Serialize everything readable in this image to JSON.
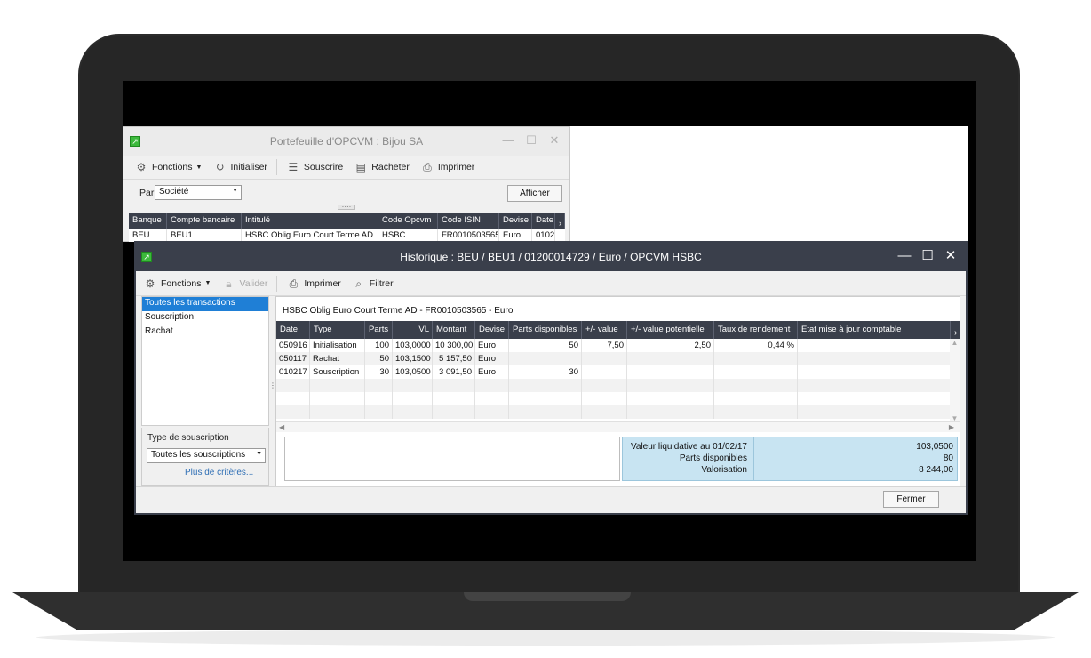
{
  "back_window": {
    "title": "Portefeuille d'OPCVM  : Bijou SA",
    "toolbar": {
      "fonctions": "Fonctions",
      "initialiser": "Initialiser",
      "souscrire": "Souscrire",
      "racheter": "Racheter",
      "imprimer": "Imprimer"
    },
    "par_label": "Par",
    "par_value": "Société",
    "afficher": "Afficher",
    "columns": [
      "Banque",
      "Compte bancaire",
      "Intitulé",
      "Code Opcvm",
      "Code ISIN",
      "Devise",
      "Date"
    ],
    "rows": [
      [
        "BEU",
        "BEU1",
        "HSBC Oblig Euro Court Terme AD",
        "HSBC",
        "FR0010503565",
        "Euro",
        "0102"
      ]
    ]
  },
  "front_window": {
    "title": "Historique : BEU / BEU1 / 01200014729 / Euro / OPCVM HSBC",
    "toolbar": {
      "fonctions": "Fonctions",
      "valider": "Valider",
      "imprimer": "Imprimer",
      "filtrer": "Filtrer"
    },
    "transaction_types": [
      "Toutes les transactions",
      "Souscription",
      "Rachat"
    ],
    "filter": {
      "label": "Type de souscription",
      "value": "Toutes les souscriptions",
      "more_link": "Plus de critères..."
    },
    "group_title": "HSBC Oblig Euro Court Terme AD - FR0010503565 - Euro",
    "columns": [
      "Date",
      "Type",
      "Parts",
      "VL",
      "Montant",
      "Devise",
      "Parts disponibles",
      "+/- value",
      "+/- value potentielle",
      "Taux de rendement",
      "Etat mise à jour comptable"
    ],
    "rows": [
      [
        "050916",
        "Initialisation",
        "100",
        "103,0000",
        "10 300,00",
        "Euro",
        "50",
        "7,50",
        "2,50",
        "0,44 %",
        ""
      ],
      [
        "050117",
        "Rachat",
        "50",
        "103,1500",
        "5 157,50",
        "Euro",
        "",
        "",
        "",
        "",
        ""
      ],
      [
        "010217",
        "Souscription",
        "30",
        "103,0500",
        "3 091,50",
        "Euro",
        "30",
        "",
        "",
        "",
        ""
      ]
    ],
    "summary": {
      "labels": [
        "Valeur liquidative au 01/02/17",
        "Parts disponibles",
        "Valorisation"
      ],
      "values": [
        "103,0500",
        "80",
        "8 244,00"
      ]
    },
    "fermer": "Fermer"
  }
}
